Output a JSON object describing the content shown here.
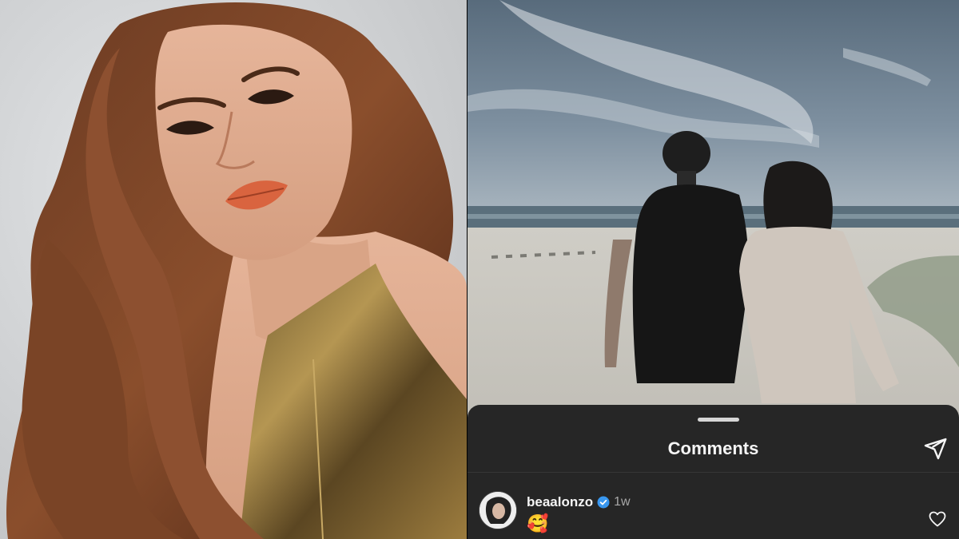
{
  "comments_sheet": {
    "title": "Comments",
    "share_icon": "paper-plane-icon",
    "comments": [
      {
        "username": "beaalonzo",
        "verified": true,
        "age": "1w",
        "text": "🥰",
        "like_icon": "heart-outline-icon"
      }
    ]
  },
  "colors": {
    "sheet_bg": "#262626",
    "text_primary": "#f5f5f5",
    "text_secondary": "#a8a8a8",
    "verified_blue": "#3897f0"
  }
}
